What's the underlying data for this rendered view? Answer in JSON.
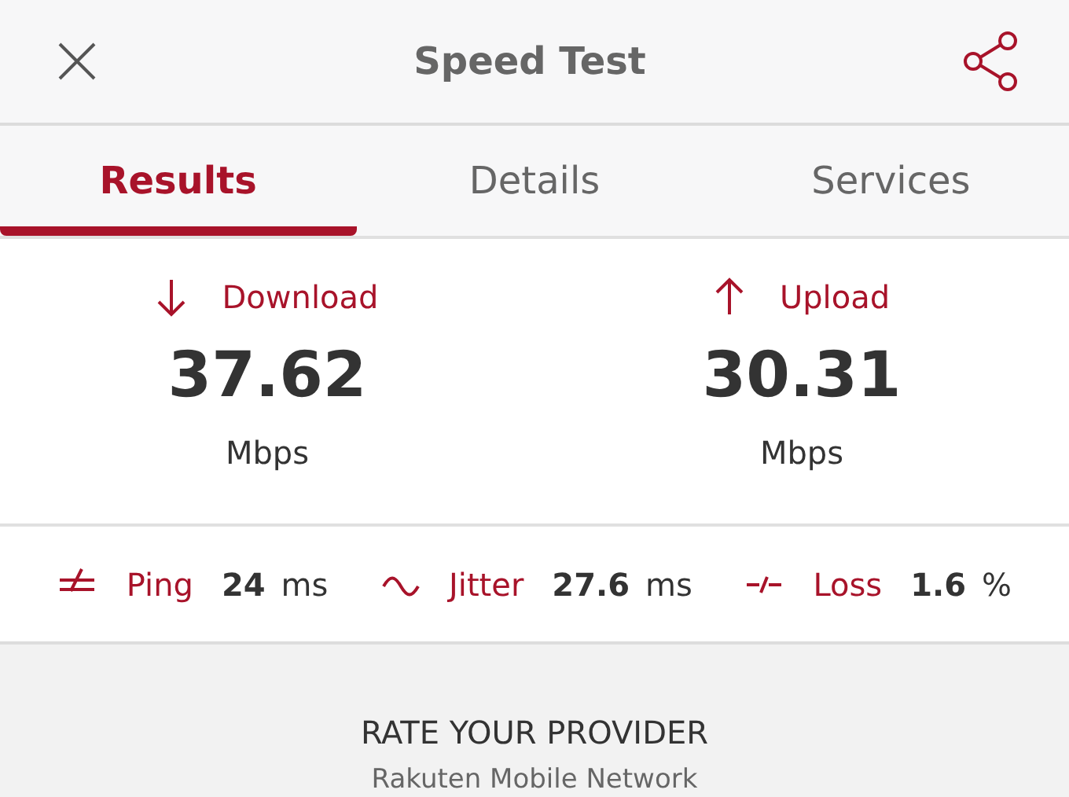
{
  "header": {
    "title": "Speed Test"
  },
  "tabs": [
    {
      "label": "Results",
      "selected": true
    },
    {
      "label": "Details",
      "selected": false
    },
    {
      "label": "Services",
      "selected": false
    }
  ],
  "speeds": [
    {
      "kind": "download",
      "label": "Download",
      "value": "37.62",
      "unit": "Mbps"
    },
    {
      "kind": "upload",
      "label": "Upload",
      "value": "30.31",
      "unit": "Mbps"
    }
  ],
  "metrics": [
    {
      "kind": "ping",
      "label": "Ping",
      "value": "24",
      "unit": "ms"
    },
    {
      "kind": "jitter",
      "label": "Jitter",
      "value": "27.6",
      "unit": "ms"
    },
    {
      "kind": "loss",
      "label": "Loss",
      "value": "1.6",
      "unit": "%"
    }
  ],
  "rating": {
    "heading": "RATE YOUR PROVIDER",
    "provider": "Rakuten Mobile Network"
  }
}
